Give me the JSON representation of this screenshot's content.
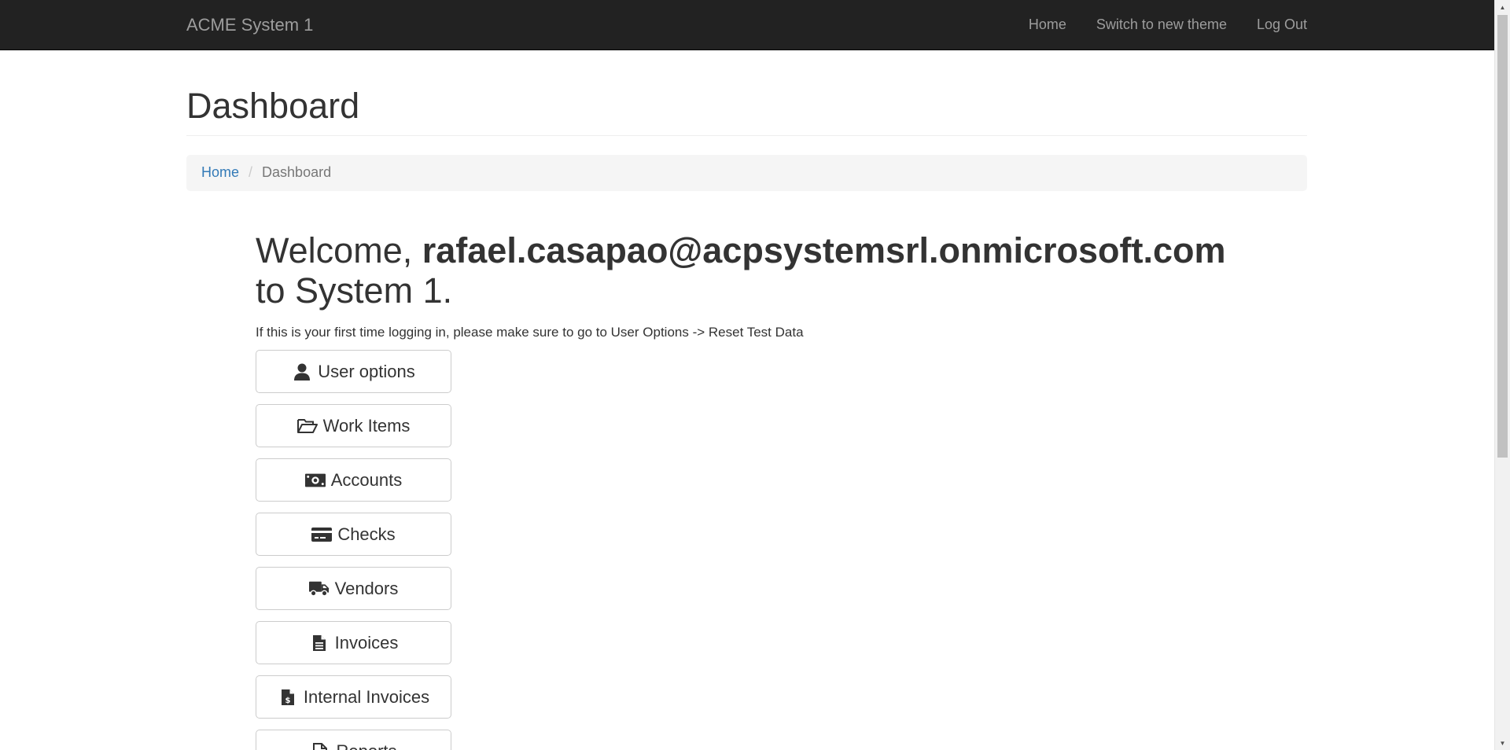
{
  "navbar": {
    "brand": "ACME System 1",
    "links": [
      "Home",
      "Switch to new theme",
      "Log Out"
    ]
  },
  "header": {
    "title": "Dashboard"
  },
  "breadcrumb": {
    "home": "Home",
    "separator": "/",
    "current": "Dashboard"
  },
  "welcome": {
    "prefix": "Welcome, ",
    "user": "rafael.casapao@acpsystemsrl.onmicrosoft.com",
    "suffix": "to System 1.",
    "hint": "If this is your first time logging in, please make sure to go to User Options -> Reset Test Data"
  },
  "menu": [
    {
      "label": "User options",
      "icon": "user-icon"
    },
    {
      "label": "Work Items",
      "icon": "folder-open-icon"
    },
    {
      "label": "Accounts",
      "icon": "money-bill-icon"
    },
    {
      "label": "Checks",
      "icon": "credit-card-icon"
    },
    {
      "label": "Vendors",
      "icon": "truck-icon"
    },
    {
      "label": "Invoices",
      "icon": "file-text-icon"
    },
    {
      "label": "Internal Invoices",
      "icon": "file-invoice-dollar-icon"
    },
    {
      "label": "Reports",
      "icon": "file-icon"
    }
  ],
  "colors": {
    "navbar_bg": "#222222",
    "navbar_text": "#9d9d9d",
    "link": "#337ab7",
    "breadcrumb_bg": "#f5f5f5"
  }
}
